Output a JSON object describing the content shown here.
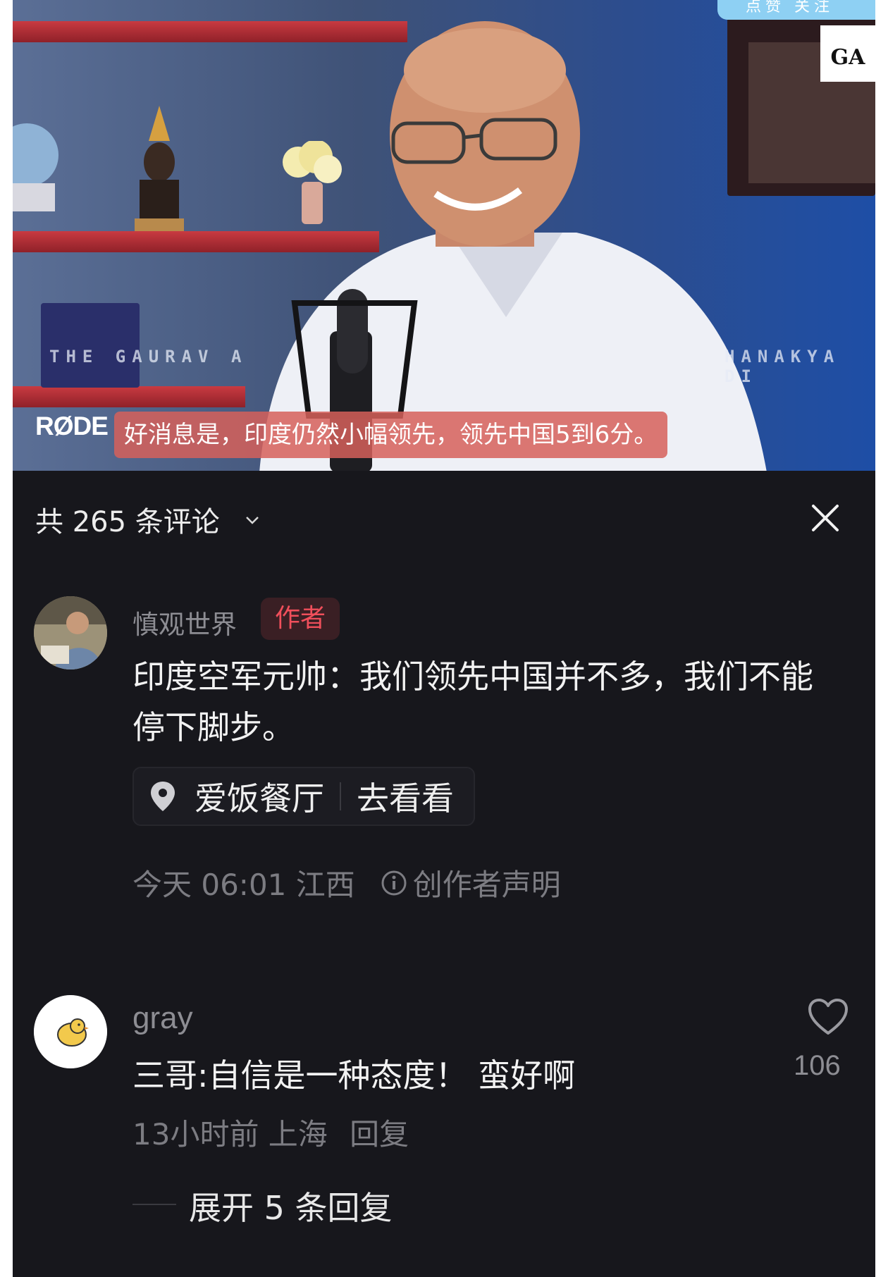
{
  "video": {
    "subtitle": "好消息是，印度仍然小幅领先，领先中国5到6分。",
    "brand_mic": "RØDE",
    "watermark_left": "THE GAURAV A",
    "watermark_right": "HANAKYA DI",
    "logo_text": "GA",
    "top_pill": "点赞 关注"
  },
  "comments_header": {
    "count_label": "共 265 条评论",
    "chevron_icon": "chevron-down-icon",
    "close_icon": "close-icon"
  },
  "author_comment": {
    "username": "慎观世界",
    "badge": "作者",
    "text": "印度空军元帅：我们领先中国并不多，我们不能停下脚步。",
    "location": {
      "icon": "location-pin-icon",
      "name": "爱饭餐厅",
      "action": "去看看"
    },
    "meta": "今天 06:01 江西",
    "statement": "创作者声明"
  },
  "comment": {
    "username": "gray",
    "text": "三哥:自信是一种态度！ 蛮好啊",
    "meta": "13小时前 上海",
    "reply_label": "回复",
    "like_icon": "heart-icon",
    "like_count": "106",
    "expand_label": "展开 5 条回复"
  },
  "colors": {
    "background": "#17171c",
    "author_badge_text": "#f04f5b",
    "subtitle_bg": "#d6605a"
  }
}
